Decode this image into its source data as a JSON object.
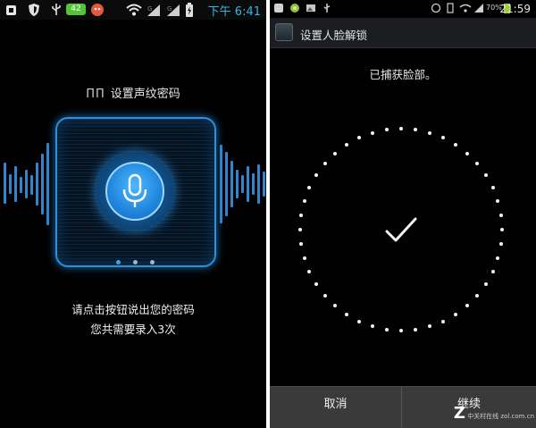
{
  "left": {
    "status_time": "下午 6:41",
    "battery_level": "42",
    "title_mark": "ΠΠ",
    "title": "设置声纹密码",
    "instruction_line1": "请点击按钮说出您的密码",
    "instruction_line2": "您共需要录入3次",
    "accent_color": "#33b5e5"
  },
  "right": {
    "status_time": "21:59",
    "battery_percent": "70%",
    "header_title": "设置人脸解锁",
    "captured_text": "已捕获脸部。",
    "cancel_label": "取消",
    "continue_label": "继续",
    "watermark_brand": "Z",
    "watermark_text": "中关村在线 zol.com.cn"
  }
}
